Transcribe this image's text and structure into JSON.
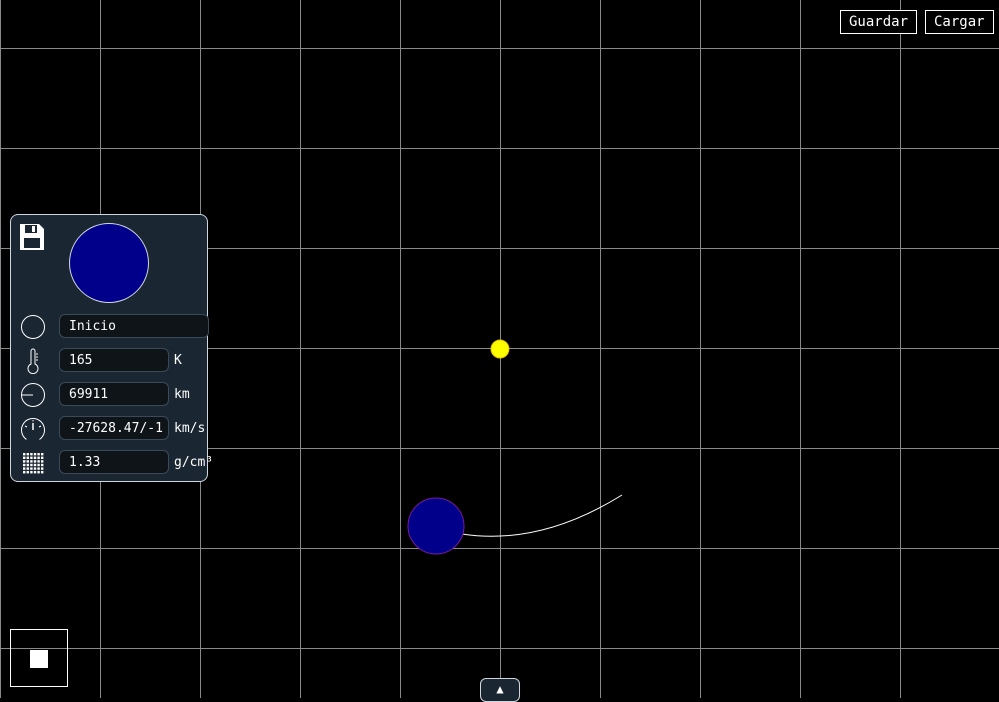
{
  "toolbar": {
    "save_label": "Guardar",
    "load_label": "Cargar"
  },
  "panel": {
    "name_value": "Inicio",
    "temperature": {
      "value": "165",
      "unit": "K"
    },
    "radius": {
      "value": "69911",
      "unit": "km"
    },
    "velocity": {
      "value": "-27628.47/-1",
      "unit": "km/s"
    },
    "density": {
      "value": "1.33",
      "unit": "g/cm³"
    },
    "preview_color": "#00008b"
  },
  "scene": {
    "background": "#000000",
    "grid_color": "#8a8a8a",
    "sun_color": "#ffff00",
    "planet_color": "#00008b",
    "planet_outline": "#6a0dad",
    "orbit_color": "#ffffff"
  },
  "toggle_arrow": "▲",
  "icons": [
    "floppy-disk-icon",
    "circle-name-icon",
    "thermometer-icon",
    "radius-icon",
    "speedometer-icon",
    "density-grid-icon"
  ]
}
